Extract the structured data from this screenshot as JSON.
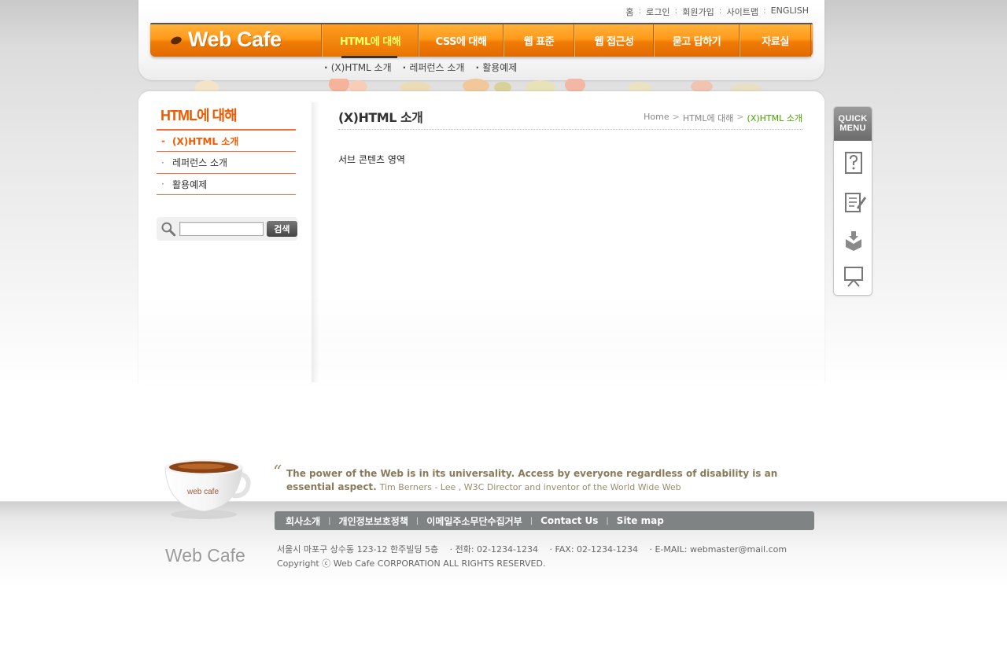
{
  "top_links": [
    "홈",
    "로그인",
    "회원가입",
    "사이트맵",
    "ENGLISH"
  ],
  "logo_text": "Web Cafe",
  "gnb": [
    {
      "label": "HTML에 대해",
      "active": true
    },
    {
      "label": "CSS에 대해",
      "active": false
    },
    {
      "label": "웹 표준",
      "active": false
    },
    {
      "label": "웹 접근성",
      "active": false
    },
    {
      "label": "묻고 답하기",
      "active": false
    },
    {
      "label": "자료실",
      "active": false
    }
  ],
  "subnav": [
    "(X)HTML 소개",
    "레퍼런스 소개",
    "활용예제"
  ],
  "lnb": {
    "title": "HTML에 대해",
    "items": [
      {
        "label": "(X)HTML 소개",
        "mark": "-",
        "active": true
      },
      {
        "label": "레퍼런스 소개",
        "mark": "·",
        "active": false
      },
      {
        "label": "활용예제",
        "mark": "·",
        "active": false
      }
    ]
  },
  "search": {
    "button_label": "검색",
    "value": ""
  },
  "page_title": "(X)HTML 소개",
  "breadcrumb": [
    "Home",
    "HTML에 대해",
    "(X)HTML 소개"
  ],
  "sub_content": "서브 콘텐츠 영역",
  "quick_menu": {
    "head_line1": "QUICK",
    "head_line2": "MENU",
    "icons": [
      "question-icon",
      "notepad-edit-icon",
      "download-box-icon",
      "presentation-board-icon"
    ]
  },
  "footer": {
    "cup_label": "web cafe",
    "quote_main": "The power of the Web is in its universality. Access by everyone regardless of disability is an essential aspect.",
    "quote_author": "Tim Berners - Lee , W3C Director and inventor of the World Wide Web",
    "nav": [
      "회사소개",
      "개인정보보호정책",
      "이메일주소무단수집거부",
      "Contact Us",
      "Site map"
    ],
    "logo_text": "Web Cafe",
    "address": "서울시 마포구 상수동 123-12 한주빌딩 5층　 · 전화: 02-1234-1234 　· FAX: 02-1234-1234 　· E-MAIL: webmaster@mail.com",
    "copyright": "Copyright ⓒ Web Cafe CORPORATION ALL RIGHTS RESERVED."
  },
  "colors": {
    "accent_orange": "#f05a00",
    "breadcrumb_current": "#48a000",
    "footer_nav_bg": "#7f8384"
  }
}
